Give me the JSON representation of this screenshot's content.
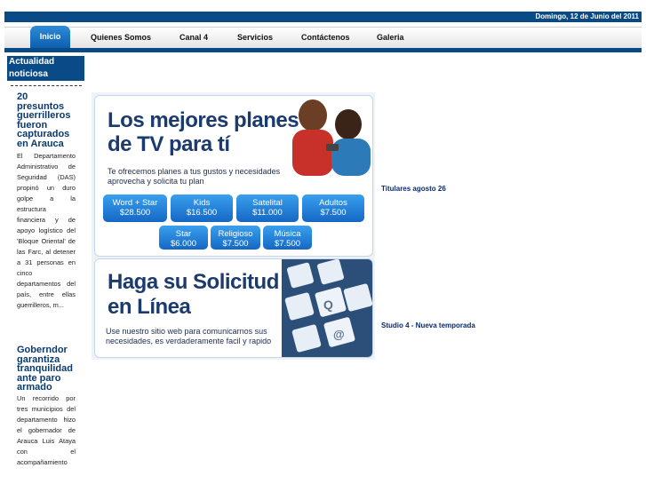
{
  "header": {
    "date": "Domingo, 12 de Junio del 2011"
  },
  "nav": {
    "items": [
      {
        "label": "Inicio"
      },
      {
        "label": "Quienes Somos"
      },
      {
        "label": "Canal 4"
      },
      {
        "label": "Servicios"
      },
      {
        "label": "Contáctenos"
      },
      {
        "label": "Galeria"
      }
    ]
  },
  "sidebar": {
    "heading": "Actualidad noticiosa",
    "news": [
      {
        "title": "20 presuntos guerrilleros fueron capturados en Arauca",
        "body": "El Departamento Administrativo de Seguridad (DAS) propinó un duro golpe a la estructura financiera y de apoyo logístico del 'Bloque Oriental' de las Farc, al detener a 31 personas en cinco departamentos del país, entre ellas guerrilleros, m..."
      },
      {
        "title": "Goberndor garantiza tranquilidad ante paro armado",
        "body": "Un recorrido por tres municipios del departamento hizo el gobernador de Arauca Luis Ataya con el acompañamiento"
      }
    ]
  },
  "banner1": {
    "headline": "Los mejores planes de TV para tí",
    "subtitle": "Te ofrecemos planes a tus gustos y necesidades aprovecha y solicita tu plan",
    "plans": [
      {
        "name": "Word + Star",
        "price": "$28.500"
      },
      {
        "name": "Kids",
        "price": "$16.500"
      },
      {
        "name": "Satelital",
        "price": "$11.000"
      },
      {
        "name": "Adultos",
        "price": "$7.500"
      },
      {
        "name": "Star",
        "price": "$6.000"
      },
      {
        "name": "Religioso",
        "price": "$7.500"
      },
      {
        "name": "Música",
        "price": "$7.500"
      }
    ]
  },
  "banner2": {
    "headline": "Haga su Solicitud en Línea",
    "subtitle": "Use nuestro sitio web para comunicarnos sus necesidades, es verdaderamente facil y rapido"
  },
  "links": {
    "titulares": "Titulares agosto 26",
    "studio": "Studio 4 - Nueva temporada"
  }
}
